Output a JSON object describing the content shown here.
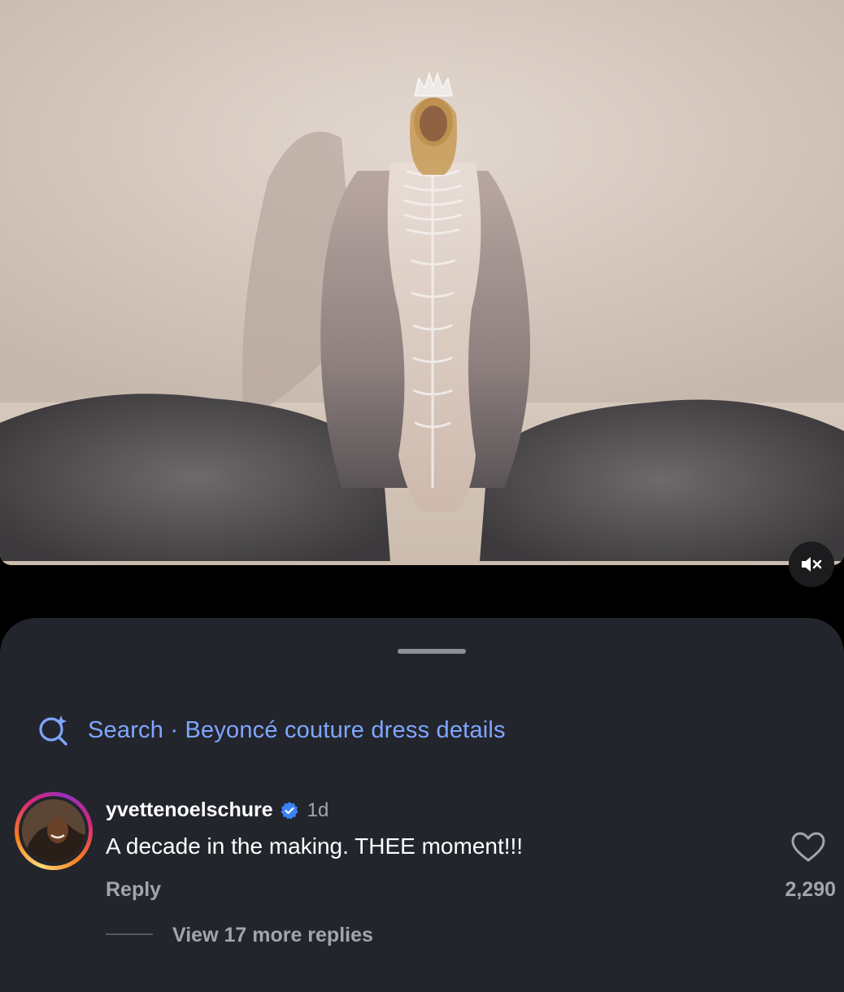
{
  "photo": {
    "alt_icon": "feather-gown-photo"
  },
  "mute_button": {
    "icon": "speaker-muted-icon"
  },
  "search": {
    "icon": "sparkle-search-icon",
    "label": "Search · Beyoncé couture dress details",
    "color": "#7fa6ff"
  },
  "comment": {
    "username": "yvettenoelschure",
    "verified_icon": "verified-badge-icon",
    "time": "1d",
    "text": "A decade in the making.  THEE moment!!!",
    "reply_label": "Reply",
    "like_count": "2,290",
    "view_more": "View 17 more replies"
  }
}
